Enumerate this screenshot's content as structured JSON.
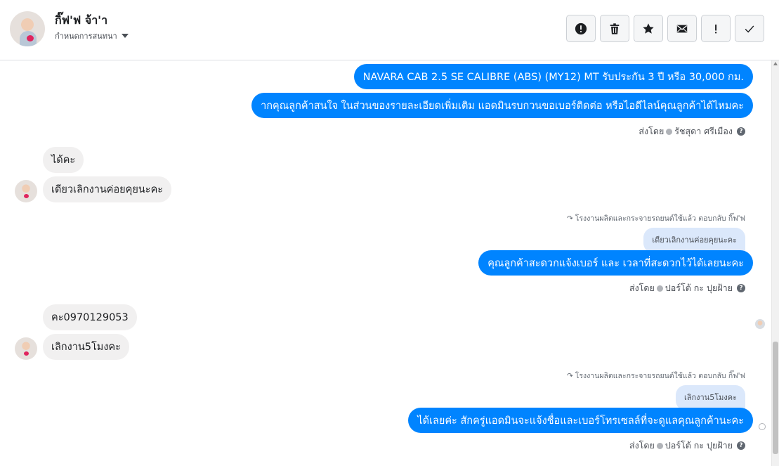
{
  "header": {
    "name": "กิ๊ฟ'ฟ จ้า'า",
    "subtitle": "กำหนดการสนทนา",
    "actions": [
      {
        "icon": "alert-circle-icon",
        "label": "spam"
      },
      {
        "icon": "trash-icon",
        "label": "delete"
      },
      {
        "icon": "star-icon",
        "label": "star"
      },
      {
        "icon": "envelope-icon",
        "label": "mark-unread"
      },
      {
        "icon": "exclamation-icon",
        "label": "follow-up"
      },
      {
        "icon": "check-icon",
        "label": "done"
      }
    ]
  },
  "messages": {
    "out1": "NAVARA CAB 2.5 SE CALIBRE (ABS) (MY12) MT รับประกัน 3 ปี หรือ 30,000 กม.",
    "out2": "ากคุณลูกค้าสนใจ ในส่วนของรายละเอียดเพิ่มเติม แอดมินรบกวนขอเบอร์ติดต่อ หรือไอดีไลน์คุณลูกค้าได้ไหมคะ",
    "sent1": "ส่งโดย",
    "sent1_name": "รัชสุดา ศรีเมือง",
    "in1": "ได้คะ",
    "in2": "เดียวเลิกงานค่อยคุยนะคะ",
    "reply_note1": "โรงงานผลิตและกระจายรถยนต์ใช้แล้ว ตอบกลับ กิ๊ฟ'ฟ",
    "quote1": "เดียวเลิกงานค่อยคุยนะคะ",
    "out3": "คุณลูกค้าสะดวกแจ้งเบอร์ และ เวลาที่สะดวกไว้ได้เลยนะคะ",
    "sent2": "ส่งโดย",
    "sent2_name": "ปอร์โต้ กะ ปุยฝ้าย",
    "in3": "คะ0970129053",
    "in4": "เลิกงาน5โมงคะ",
    "reply_note2": "โรงงานผลิตและกระจายรถยนต์ใช้แล้ว ตอบกลับ กิ๊ฟ'ฟ",
    "quote2": "เลิกงาน5โมงคะ",
    "out4": "ได้เลยค่ะ สักครู่แอดมินจะแจ้งชื่อและเบอร์โทรเซลล์ที่จะดูแลคุณลูกค้านะคะ",
    "sent3": "ส่งโดย",
    "sent3_name": "ปอร์โต้ กะ ปุยฝ้าย"
  },
  "colors": {
    "outgoing": "#0084ff",
    "incoming": "#f1f0f0",
    "quote": "#dbe8fb"
  }
}
